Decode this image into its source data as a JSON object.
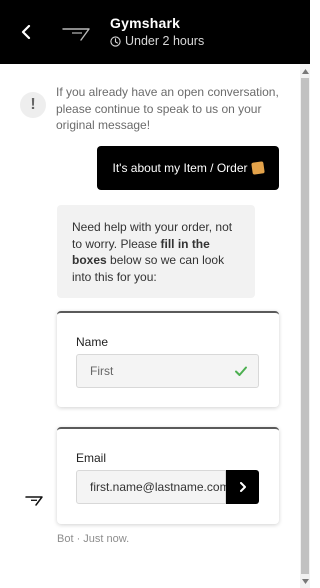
{
  "header": {
    "title": "Gymshark",
    "subtitle": "Under 2 hours",
    "back_icon": "chevron-left-icon",
    "clock_icon": "clock-icon",
    "colors": {
      "background": "#000000",
      "text": "#ffffff",
      "subtext": "#d8d8d8"
    }
  },
  "conversation": {
    "notice": "If you already have an open conversation, please continue to speak to us on your original message!",
    "user_message": "It's about my Item / Order",
    "bot_message_parts": {
      "lead": "Need help with your order, not to worry. Please ",
      "bold": "fill in the boxes",
      "tail": " below so we can look into this for you:"
    },
    "bot_meta": "Bot · Just now."
  },
  "forms": {
    "name": {
      "label": "Name",
      "value": "First",
      "status_icon": "check-icon"
    },
    "email": {
      "label": "Email",
      "value": "first.name@lastname.com",
      "submit_icon": "chevron-right-icon"
    }
  },
  "colors": {
    "accent_check": "#4caf50",
    "bubble_user": "#000000",
    "bubble_bot": "#f2f2f2"
  }
}
